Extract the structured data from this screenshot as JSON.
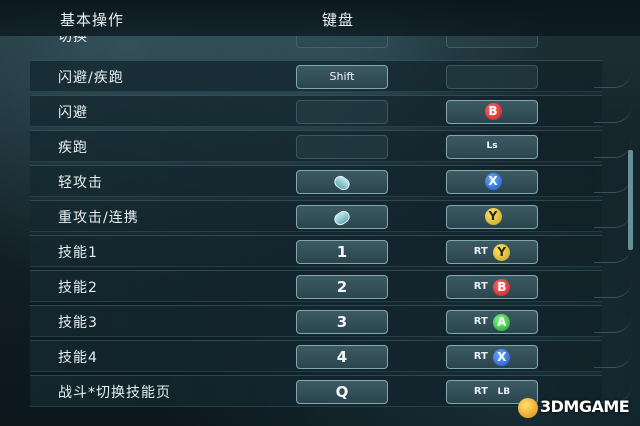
{
  "header": {
    "basic_ops": "基本操作",
    "keyboard": "键盘"
  },
  "partial_row": {
    "label": "切换"
  },
  "rows": [
    {
      "label": "闪避/疾跑",
      "key": "Shift",
      "pad_kind": "empty"
    },
    {
      "label": "闪避",
      "key": "",
      "pad_button": "B"
    },
    {
      "label": "疾跑",
      "key": "",
      "pad_text": "Ls"
    },
    {
      "label": "轻攻击",
      "key_icon": "mouse-left-icon",
      "pad_button": "X"
    },
    {
      "label": "重攻击/连携",
      "key_icon": "mouse-right-icon",
      "pad_button": "Y"
    },
    {
      "label": "技能1",
      "key": "1",
      "pad_prefix": "RT",
      "pad_button": "Y"
    },
    {
      "label": "技能2",
      "key": "2",
      "pad_prefix": "RT",
      "pad_button": "B"
    },
    {
      "label": "技能3",
      "key": "3",
      "pad_prefix": "RT",
      "pad_button": "A"
    },
    {
      "label": "技能4",
      "key": "4",
      "pad_prefix": "RT",
      "pad_button": "X"
    },
    {
      "label": "战斗*切换技能页",
      "key": "Q",
      "pad_prefix": "RT",
      "pad_suffix": "LB"
    }
  ],
  "watermark": "3DMGAME",
  "colors": {
    "btn_b": "#e03a3a",
    "btn_x": "#3a7ae0",
    "btn_y": "#e0c23a",
    "btn_a": "#2fb84a"
  }
}
